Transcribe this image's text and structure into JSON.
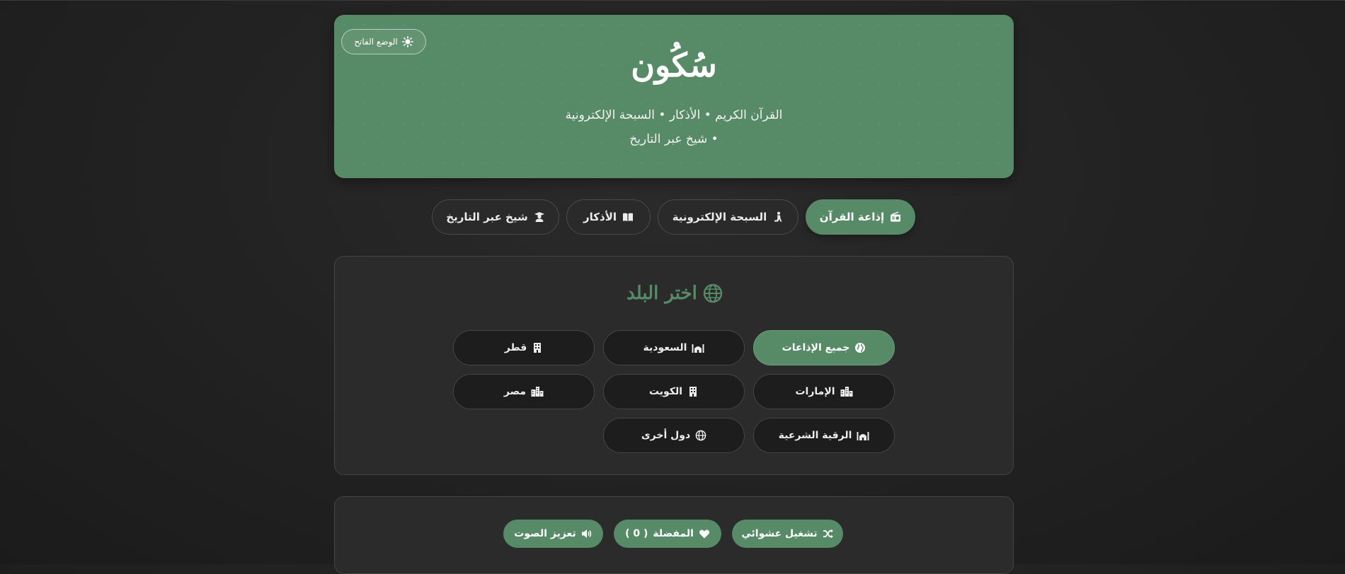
{
  "header": {
    "theme_toggle_label": "الوضع الفاتح",
    "logo_text": "سُكُون",
    "tagline_line1": "القرآن الكريم • الأذكار • السبحة الإلكترونية",
    "tagline_line2": "• شيخ عبر التاريخ",
    "accent_color": "#578a66"
  },
  "main_nav": [
    {
      "label": "إذاعة القرآن",
      "icon": "radio-icon",
      "active": true
    },
    {
      "label": "السبحة الإلكترونية",
      "icon": "praying-person-icon",
      "active": false
    },
    {
      "label": "الأذكار",
      "icon": "book-icon",
      "active": false
    },
    {
      "label": "شيخ عبر التاريخ",
      "icon": "scholar-icon",
      "active": false
    }
  ],
  "country_panel": {
    "title": "اختر البلد",
    "title_icon": "globe-icon",
    "countries": [
      {
        "label": "جميع الإذاعات",
        "icon": "globe-icon",
        "active": true
      },
      {
        "label": "السعودية",
        "icon": "mosque-icon",
        "active": false
      },
      {
        "label": "قطر",
        "icon": "building-icon",
        "active": false
      },
      {
        "label": "الإمارات",
        "icon": "city-icon",
        "active": false
      },
      {
        "label": "الكويت",
        "icon": "building-icon",
        "active": false
      },
      {
        "label": "مصر",
        "icon": "city-icon",
        "active": false
      },
      {
        "label": "الرقية الشرعية",
        "icon": "mosque-icon",
        "active": false
      },
      {
        "label": "دول أخرى",
        "icon": "globe-icon",
        "active": false
      }
    ]
  },
  "controls": {
    "shuffle_label": "تشغيل عشوائي",
    "favorites_label": "المفضلة",
    "favorites_count": "( 0 )",
    "volume_boost_label": "تعزيز الصوت"
  }
}
